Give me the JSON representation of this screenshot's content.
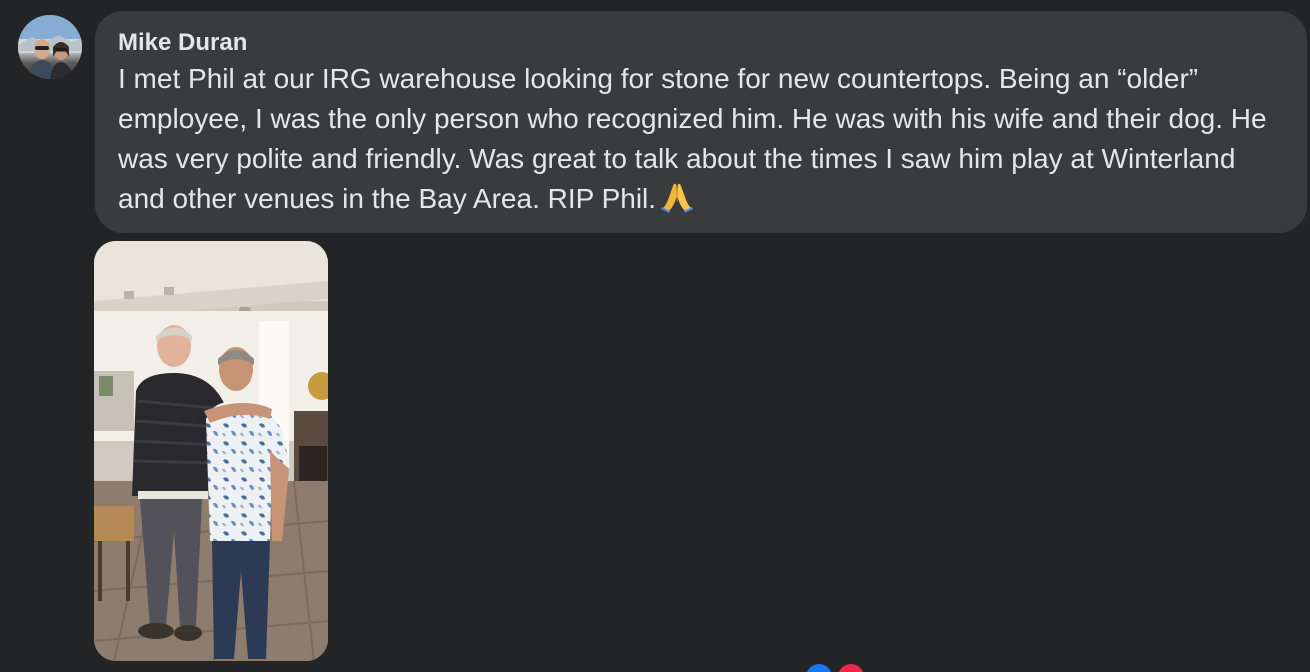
{
  "comment": {
    "author": "Mike Duran",
    "text": "I met Phil at our IRG warehouse looking for stone for new countertops. Being an “older” employee, I was the only person who recognized him. He was with his wife and their dog. He was very polite and friendly. Was great to talk about the times I saw him play at Winterland and other venues in the Bay Area. RIP Phil.",
    "emoji": "folded-hands"
  },
  "attachment": {
    "type": "photo"
  },
  "colors": {
    "background": "#232426",
    "bubble": "#3a3b3c",
    "text": "#e4e6eb",
    "reaction_like": "#1877f2",
    "reaction_love": "#f0284a"
  }
}
